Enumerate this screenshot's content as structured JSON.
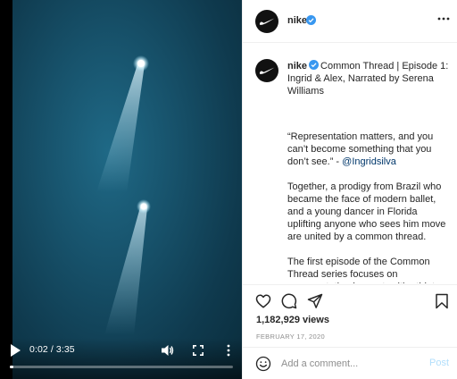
{
  "video": {
    "time_display": "0:02 / 3:35",
    "progress": 0.014,
    "icons": [
      "play-icon",
      "volume-icon",
      "fullscreen-icon",
      "more-vertical-icon"
    ]
  },
  "header": {
    "username": "nike",
    "verified": true,
    "more_icon": "more-horizontal-icon"
  },
  "caption": {
    "username": "nike",
    "title": "Common Thread | Episode 1: Ingrid & Alex, Narrated by Serena Williams",
    "quote": "“Representation matters, and you can’t become something that you don’t see.” -",
    "mention": "@Ingridsilva",
    "paragraph2": "Together, a prodigy from Brazil who became the face of modern ballet, and a young dancer in Florida uplifting anyone who sees him move are united by a common thread.",
    "paragraph3": "The first episode of the Common Thread series focuses on representation in sport, with athletes Ingrid Silva and Alex"
  },
  "actions": {
    "icons": [
      "heart-icon",
      "comment-icon",
      "share-icon",
      "bookmark-icon"
    ],
    "views": "1,182,929 views",
    "date": "FEBRUARY 17, 2020"
  },
  "comment_box": {
    "placeholder": "Add a comment...",
    "post_label": "Post"
  },
  "colors": {
    "verified_blue": "#3897f0",
    "post_button_disabled": "#b2dffc",
    "mention_link": "#00376b",
    "video_teal": "#17526b"
  }
}
